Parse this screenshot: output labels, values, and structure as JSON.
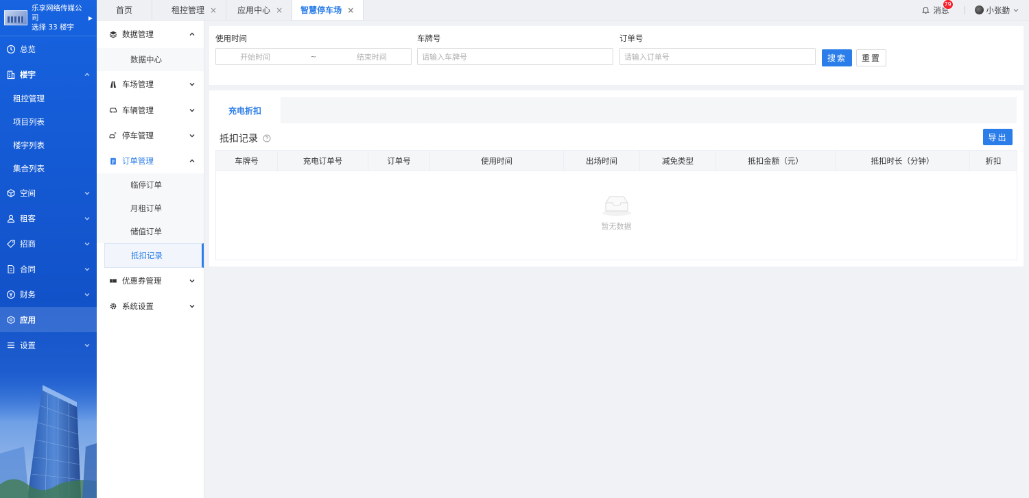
{
  "sidebar": {
    "company_name": "乐享网络传媒公司",
    "building_select": "选择 33 楼宇",
    "nav": [
      {
        "label": "总览",
        "icon": "clock-icon"
      },
      {
        "label": "楼宇",
        "icon": "building-icon",
        "expanded": true
      },
      {
        "label": "空间",
        "icon": "cube-icon"
      },
      {
        "label": "租客",
        "icon": "user-icon"
      },
      {
        "label": "招商",
        "icon": "tag-icon"
      },
      {
        "label": "合同",
        "icon": "document-icon"
      },
      {
        "label": "财务",
        "icon": "coin-icon"
      },
      {
        "label": "应用",
        "icon": "app-cube-icon",
        "active": true
      },
      {
        "label": "设置",
        "icon": "menu-icon"
      }
    ],
    "building_sub": [
      "租控管理",
      "项目列表",
      "楼宇列表",
      "集合列表"
    ]
  },
  "tabs": [
    {
      "label": "首页"
    },
    {
      "label": "租控管理"
    },
    {
      "label": "应用中心"
    },
    {
      "label": "智慧停车场",
      "active": true
    }
  ],
  "topbar": {
    "messages_label": "消息",
    "messages_count": "79",
    "user_name": "小张勤"
  },
  "subnav": {
    "items": [
      {
        "label": "数据管理",
        "icon": "layers-icon",
        "children": [
          "数据中心"
        ]
      },
      {
        "label": "车场管理",
        "icon": "road-icon"
      },
      {
        "label": "车辆管理",
        "icon": "car-icon"
      },
      {
        "label": "停车管理",
        "icon": "parking-car-icon"
      },
      {
        "label": "订单管理",
        "icon": "clipboard-icon",
        "children": [
          "临停订单",
          "月租订单",
          "储值订单",
          "抵扣记录"
        ],
        "current_child": "抵扣记录"
      },
      {
        "label": "优惠券管理",
        "icon": "ticket-icon"
      },
      {
        "label": "系统设置",
        "icon": "gear-icon"
      }
    ]
  },
  "filter": {
    "usage_time_label": "使用时间",
    "start_placeholder": "开始时间",
    "range_sep": "~",
    "end_placeholder": "结束时间",
    "plate_label": "车牌号",
    "plate_placeholder": "请输入车牌号",
    "order_label": "订单号",
    "order_placeholder": "请输入订单号",
    "search_label": "搜索",
    "reset_label": "重置"
  },
  "panel": {
    "tab_label": "充电折扣",
    "title": "抵扣记录",
    "export_label": "导出",
    "columns": [
      "车牌号",
      "充电订单号",
      "订单号",
      "使用时间",
      "出场时间",
      "减免类型",
      "抵扣金额（元）",
      "抵扣时长（分钟）",
      "折扣"
    ],
    "empty_text": "暂无数据"
  },
  "colors": {
    "primary": "#2b7de9",
    "sidebar": "#1763e0",
    "badge": "#f5222d"
  }
}
